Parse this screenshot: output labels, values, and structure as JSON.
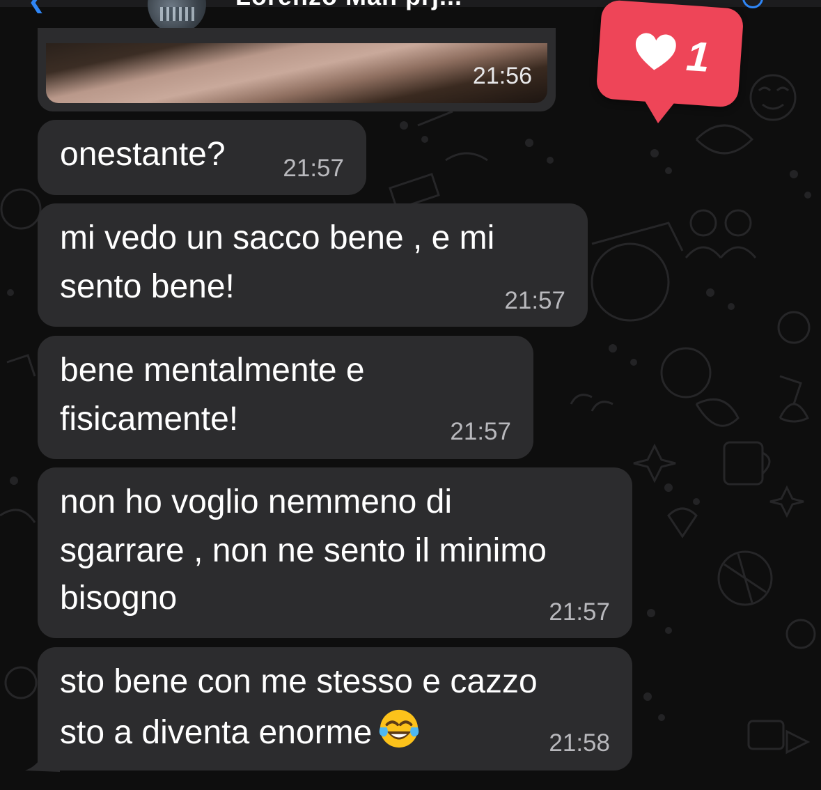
{
  "header": {
    "contact_name": "Lorenzo Man prj...",
    "back_icon": "chevron-left-icon",
    "call_icon": "phone-icon"
  },
  "media_message": {
    "time": "21:56"
  },
  "notification": {
    "icon": "heart-icon",
    "count": "1",
    "color": "#ee4558"
  },
  "messages": [
    {
      "lines": [
        "onestante?"
      ],
      "time": "21:57"
    },
    {
      "lines": [
        "mi vedo un sacco bene , e mi",
        "sento bene!"
      ],
      "time": "21:57"
    },
    {
      "lines": [
        "bene mentalmente e",
        "fisicamente!"
      ],
      "time": "21:57"
    },
    {
      "lines": [
        "non ho voglio nemmeno di",
        "sgarrare , non ne sento il minimo",
        "bisogno"
      ],
      "time": "21:57"
    },
    {
      "lines": [
        "sto bene con me stesso e cazzo",
        "sto a diventa enorme"
      ],
      "emoji": "face-with-tears-of-joy-icon",
      "time": "21:58"
    }
  ],
  "colors": {
    "bubble_incoming": "#2c2c2e",
    "accent_blue": "#2f86f6",
    "background": "#0e0e0e"
  }
}
